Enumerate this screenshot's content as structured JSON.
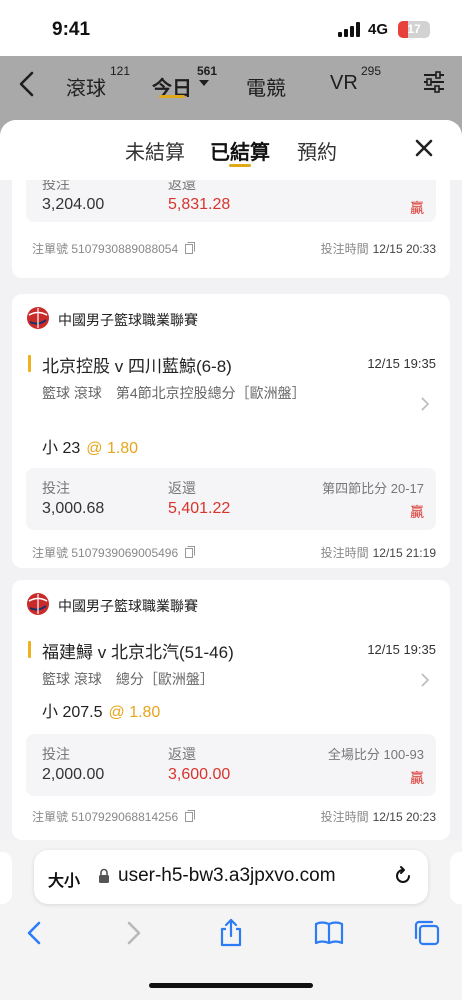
{
  "status_bar": {
    "time": "9:41",
    "network": "4G",
    "battery": "17",
    "battery_color": "#e8413c"
  },
  "app_header": {
    "tabs": [
      {
        "label": "滾球",
        "count": "121"
      },
      {
        "label": "今日",
        "count": "561"
      },
      {
        "label": "電競",
        "count": ""
      },
      {
        "label": "VR",
        "count": "295"
      }
    ],
    "active_tab": "今日",
    "icons": [
      "back-arrow-icon",
      "chevron-down-icon",
      "settings-sliders-icon"
    ]
  },
  "sheet": {
    "tabs": [
      "未結算",
      "已結算",
      "預約"
    ],
    "active_tab": "已結算",
    "accent": "#e0a81c"
  },
  "labels": {
    "stake": "投注",
    "return": "返還",
    "order_no": "注單號",
    "bet_time": "投注時間"
  },
  "bets": [
    {
      "stake": "3,204.00",
      "return": "5,831.28",
      "result": "贏",
      "order_no": "5107930889088054",
      "bet_time": "12/15 20:33"
    },
    {
      "league": "中國男子籃球職業聯賽",
      "match": "北京控股 v 四川藍鯨(6-8)",
      "match_time": "12/15 19:35",
      "bet_type": "籃球 滾球　第4節北京控股總分［歐洲盤］",
      "pick": "小 23",
      "odds": "@ 1.80",
      "stake": "3,000.68",
      "return": "5,401.22",
      "score": "第四節比分 20-17",
      "result": "贏",
      "order_no": "5107939069005496",
      "bet_time": "12/15 21:19"
    },
    {
      "league": "中國男子籃球職業聯賽",
      "match": "福建鱘 v 北京北汽(51-46)",
      "match_time": "12/15 19:35",
      "bet_type": "籃球 滾球　總分［歐洲盤］",
      "pick": "小 207.5",
      "odds": "@ 1.80",
      "stake": "2,000.00",
      "return": "3,600.00",
      "score": "全場比分 100-93",
      "result": "贏",
      "order_no": "5107929068814256",
      "bet_time": "12/15 20:23"
    }
  ],
  "colors": {
    "win_red": "#d8342c",
    "odds_orange": "#e7a51a"
  },
  "browser": {
    "text_size_label": "大小",
    "url": "user-h5-bw3.a3jpxvo.com",
    "toolbar_icons": [
      "back-icon",
      "forward-icon",
      "share-icon",
      "bookmarks-icon",
      "tabs-icon"
    ]
  }
}
